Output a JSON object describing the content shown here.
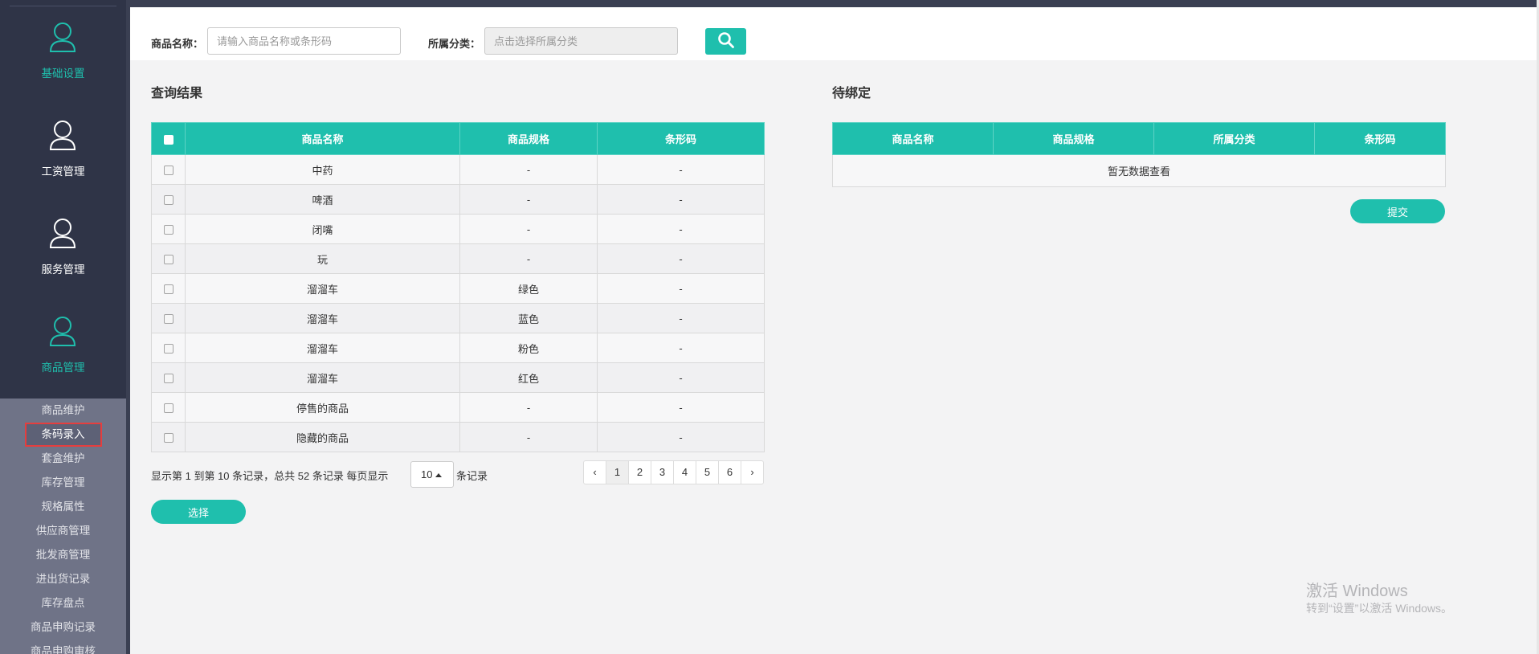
{
  "sidebar": {
    "nav": [
      {
        "label": "基础设置",
        "icon": "user-icon"
      },
      {
        "label": "工资管理",
        "icon": "user-icon"
      },
      {
        "label": "服务管理",
        "icon": "user-icon"
      },
      {
        "label": "商品管理",
        "icon": "user-icon"
      }
    ],
    "submenu": [
      "商品维护",
      "条码录入",
      "套盒维护",
      "库存管理",
      "规格属性",
      "供应商管理",
      "批发商管理",
      "进出货记录",
      "库存盘点",
      "商品申购记录",
      "商品申购审核"
    ],
    "current_submenu": "条码录入"
  },
  "filters": {
    "name_label": "商品名称：",
    "name_placeholder": "请输入商品名称或条形码",
    "category_label": "所属分类：",
    "category_placeholder": "点击选择所属分类",
    "search_icon": "search-icon"
  },
  "results": {
    "title": "查询结果",
    "columns": [
      "商品名称",
      "商品规格",
      "条形码"
    ],
    "rows": [
      [
        "中药",
        "-",
        "-"
      ],
      [
        "啤酒",
        "-",
        "-"
      ],
      [
        "闭嘴",
        "-",
        "-"
      ],
      [
        "玩",
        "-",
        "-"
      ],
      [
        "溜溜车",
        "绿色",
        "-"
      ],
      [
        "溜溜车",
        "蓝色",
        "-"
      ],
      [
        "溜溜车",
        "粉色",
        "-"
      ],
      [
        "溜溜车",
        "红色",
        "-"
      ],
      [
        "停售的商品",
        "-",
        "-"
      ],
      [
        "隐藏的商品",
        "-",
        "-"
      ]
    ],
    "pagination_info": "显示第 1 到第 10 条记录，总共 52 条记录 每页显示",
    "page_size": "10",
    "records_suffix": "条记录",
    "pages": [
      "‹",
      "1",
      "2",
      "3",
      "4",
      "5",
      "6",
      "›"
    ],
    "current_page": "1",
    "select_button": "选择"
  },
  "pending": {
    "title": "待绑定",
    "columns": [
      "商品名称",
      "商品规格",
      "所属分类",
      "条形码"
    ],
    "empty_text": "暂无数据查看",
    "submit_button": "提交"
  },
  "watermark": {
    "line1": "激活 Windows",
    "line2": "转到“设置”以激活 Windows。"
  },
  "colors": {
    "accent": "#1fbfad",
    "sidebar_bg": "#2f3447",
    "submenu_bg": "#6f7387",
    "highlight_border": "#e53e3e"
  }
}
